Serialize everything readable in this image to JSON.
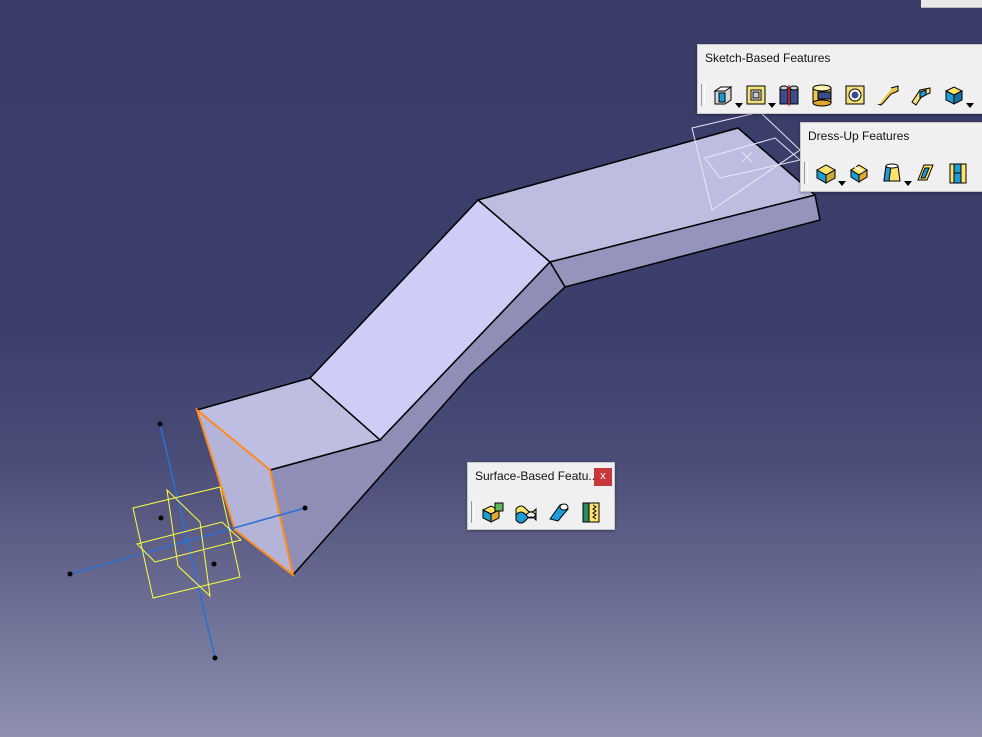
{
  "toolbars": {
    "sketch": {
      "title": "Sketch-Based Features",
      "tools": [
        {
          "icon": "pad-icon",
          "has_dropdown": true
        },
        {
          "icon": "pocket-icon",
          "has_dropdown": true
        },
        {
          "icon": "shaft-icon",
          "has_dropdown": false
        },
        {
          "icon": "groove-icon",
          "has_dropdown": false
        },
        {
          "icon": "hole-icon",
          "has_dropdown": false
        },
        {
          "icon": "rib-icon",
          "has_dropdown": false
        },
        {
          "icon": "slot-icon",
          "has_dropdown": false
        },
        {
          "icon": "stiffener-icon",
          "has_dropdown": true
        }
      ]
    },
    "dressup": {
      "title": "Dress-Up Features",
      "tools": [
        {
          "icon": "edge-fillet-icon",
          "has_dropdown": true
        },
        {
          "icon": "chamfer-icon",
          "has_dropdown": false
        },
        {
          "icon": "draft-angle-icon",
          "has_dropdown": true
        },
        {
          "icon": "shell-icon",
          "has_dropdown": false
        },
        {
          "icon": "thickness-icon",
          "has_dropdown": false
        }
      ]
    },
    "surface": {
      "title": "Surface-Based Featu...",
      "close_label": "x",
      "tools": [
        {
          "icon": "split-icon"
        },
        {
          "icon": "thick-surface-icon"
        },
        {
          "icon": "close-surface-icon"
        },
        {
          "icon": "sew-surface-icon"
        }
      ]
    }
  },
  "colors": {
    "accent_edge": "#ff8a1e",
    "axis_blue": "#2d6fd0",
    "plane_yellow": "#ffff40",
    "part_light": "#cdcdf6",
    "part_mid": "#babadf",
    "part_dark": "#8a8ab2"
  }
}
